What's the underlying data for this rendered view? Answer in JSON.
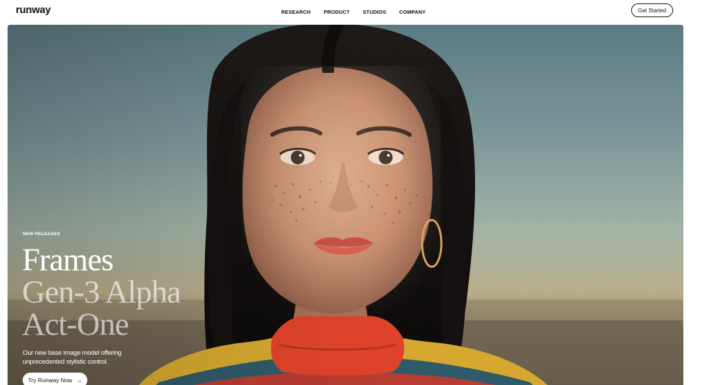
{
  "header": {
    "logo": "runway",
    "nav": [
      "RESEARCH",
      "PRODUCT",
      "STUDIOS",
      "COMPANY"
    ],
    "cta": "Get Started"
  },
  "hero": {
    "eyebrow": "NEW RELEASES",
    "headlines": [
      "Frames",
      "Gen-3 Alpha",
      "Act-One"
    ],
    "description": "Our new base image model offering unprecedented stylistic control.",
    "button_label": "Try Runway Now",
    "button_icon": "arrow-right-icon"
  },
  "colors": {
    "text": "#111111",
    "hero_text": "#ffffff",
    "hero_sky": "#6f8d92",
    "hero_ground": "#b8ae8a"
  }
}
